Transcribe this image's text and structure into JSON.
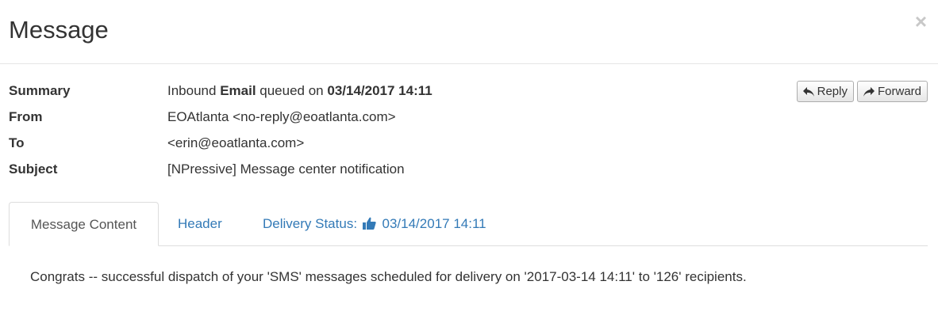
{
  "modal": {
    "title": "Message",
    "close_glyph": "×"
  },
  "summary": {
    "label": "Summary",
    "prefix": "Inbound ",
    "channel": "Email",
    "middle": " queued on ",
    "datetime": "03/14/2017 14:11"
  },
  "from": {
    "label": "From",
    "value": "EOAtlanta <no-reply@eoatlanta.com>"
  },
  "to": {
    "label": "To",
    "value": "<erin@eoatlanta.com>"
  },
  "subject": {
    "label": "Subject",
    "value": "[NPressive] Message center notification"
  },
  "actions": {
    "reply_label": "Reply",
    "reply_icon": "reply-icon",
    "forward_label": "Forward",
    "forward_icon": "forward-icon"
  },
  "tabs": {
    "message_content": "Message Content",
    "header": "Header",
    "delivery_prefix": "Delivery Status:",
    "delivery_icon": "thumbs-up-icon",
    "delivery_datetime": "03/14/2017 14:11"
  },
  "content": {
    "text": "Congrats -- successful dispatch of your 'SMS' messages scheduled for delivery on '2017-03-14 14:11' to '126' recipients."
  },
  "colors": {
    "link": "#337ab7",
    "text": "#333333",
    "border": "#dddddd"
  }
}
